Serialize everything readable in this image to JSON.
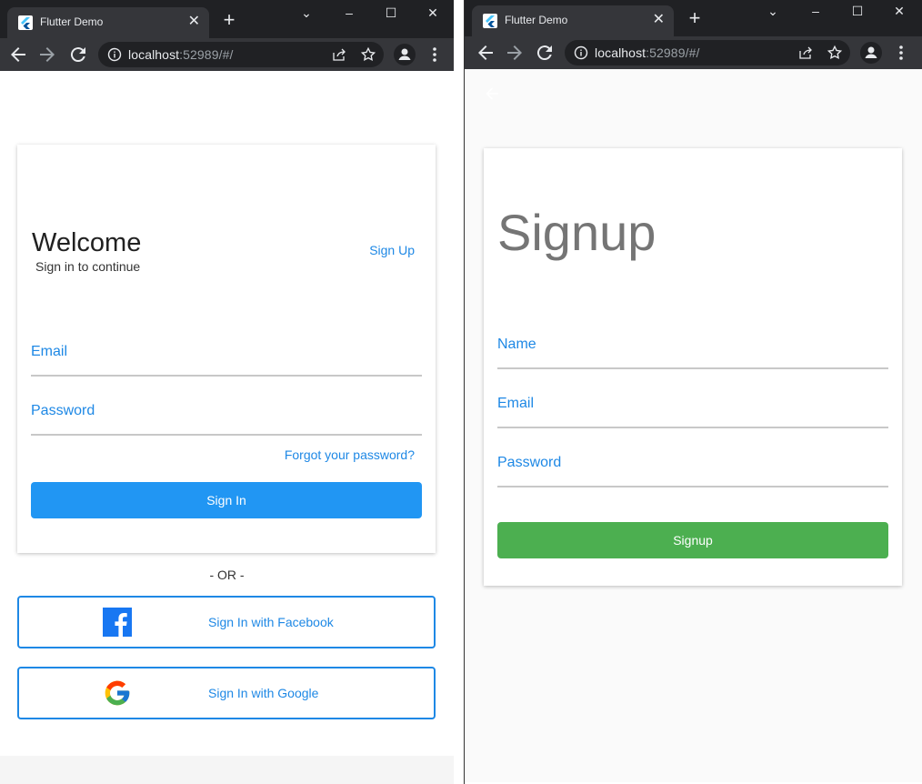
{
  "browser_left": {
    "tab_title": "Flutter Demo",
    "url_host": "localhost",
    "url_rest": ":52989/#/"
  },
  "browser_right": {
    "tab_title": "Flutter Demo",
    "url_host": "localhost",
    "url_rest": ":52989/#/"
  },
  "login": {
    "title": "Welcome",
    "subtitle": "Sign in to continue",
    "signup_link": "Sign Up",
    "email_label": "Email",
    "password_label": "Password",
    "forgot": "Forgot your password?",
    "signin_button": "Sign In",
    "or_text": "- OR -",
    "facebook_button": "Sign In with Facebook",
    "google_button": "Sign In with Google"
  },
  "signup": {
    "title": "Signup",
    "name_label": "Name",
    "email_label": "Email",
    "password_label": "Password",
    "signup_button": "Signup"
  },
  "colors": {
    "accent_blue": "#1e88e5",
    "button_blue": "#2196f3",
    "button_green": "#4caf50",
    "chrome_dark": "#202124",
    "chrome_toolbar": "#35363a"
  }
}
